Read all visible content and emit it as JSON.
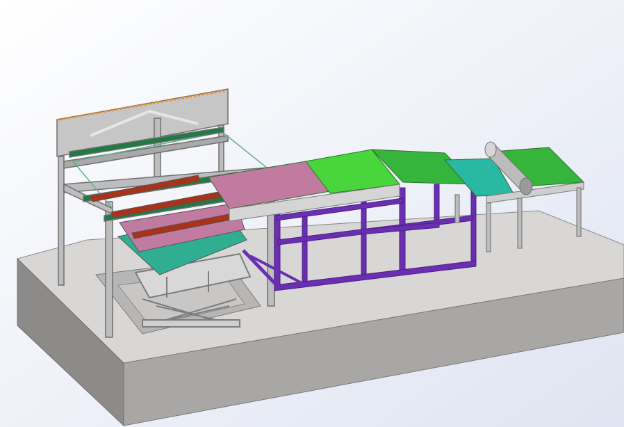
{
  "scene": {
    "colors": {
      "bg_top": "#ffffff",
      "bg_bottom": "#dfe4f2",
      "base_top": "#d9d7d6",
      "base_front": "#a9a7a6",
      "base_side": "#8d8b8a",
      "frame": "#bdbdbd",
      "frame_dark": "#6f6f6f",
      "purple": "#6a2fb0",
      "green_bright": "#49d63c",
      "green_mid": "#36b53d",
      "teal": "#29b9a3",
      "pink": "#c27ba0",
      "red": "#a8321a",
      "orange": "#f08a1c",
      "glass": "#5fae8f"
    },
    "parts": [
      "base-platform",
      "lifting-frame",
      "scissor-lift",
      "purple-conveyor-frame",
      "green-conveyor",
      "roller-conveyor"
    ]
  }
}
